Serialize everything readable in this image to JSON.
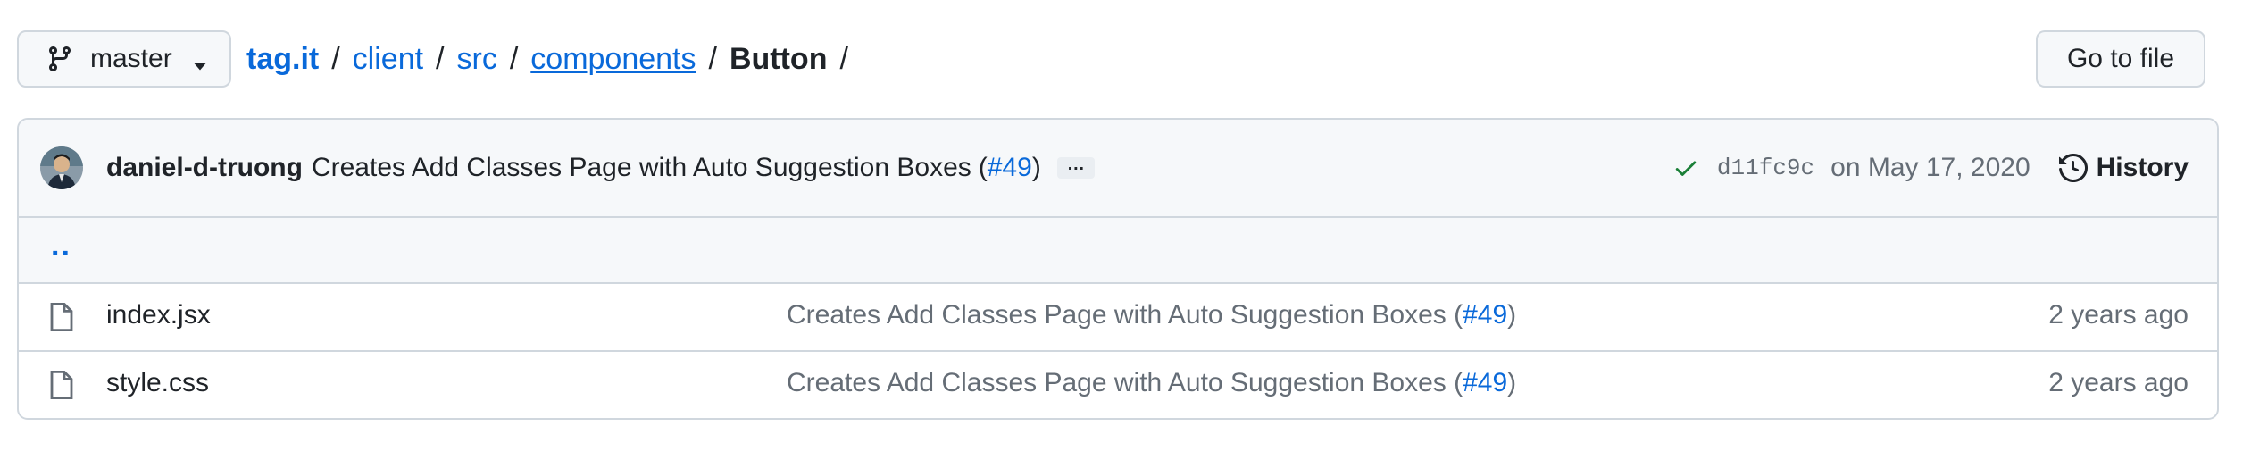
{
  "branch": {
    "name": "master",
    "icon": "git-branch-icon",
    "caret_icon": "triangle-down-icon"
  },
  "breadcrumb": {
    "repo": "tag.it",
    "parts": [
      "client",
      "src",
      "components"
    ],
    "current": "Button",
    "separator": "/"
  },
  "goto_file": {
    "label": "Go to file"
  },
  "latest_commit": {
    "author": "daniel-d-truong",
    "message": "Creates Add Classes Page with Auto Suggestion Boxes",
    "pr_open": "(",
    "pr_link": "#49",
    "pr_close": ")",
    "ellipsis": "…",
    "status_icon": "check-icon",
    "status_color": "#1a7f37",
    "sha": "d11fc9c",
    "date": "on May 17, 2020",
    "history_label": "History",
    "history_icon": "history-clock-icon"
  },
  "parent_dir": {
    "label": ".."
  },
  "files": [
    {
      "name": "index.jsx",
      "icon": "file-icon",
      "commit_message": "Creates Add Classes Page with Auto Suggestion Boxes (",
      "commit_link": "#49",
      "commit_close": ")",
      "age": "2 years ago"
    },
    {
      "name": "style.css",
      "icon": "file-icon",
      "commit_message": "Creates Add Classes Page with Auto Suggestion Boxes (",
      "commit_link": "#49",
      "commit_close": ")",
      "age": "2 years ago"
    }
  ],
  "colors": {
    "link": "#0969da",
    "border": "#d0d7de",
    "header_bg": "#f6f8fa",
    "text": "#1f2328",
    "muted": "#656d76"
  }
}
